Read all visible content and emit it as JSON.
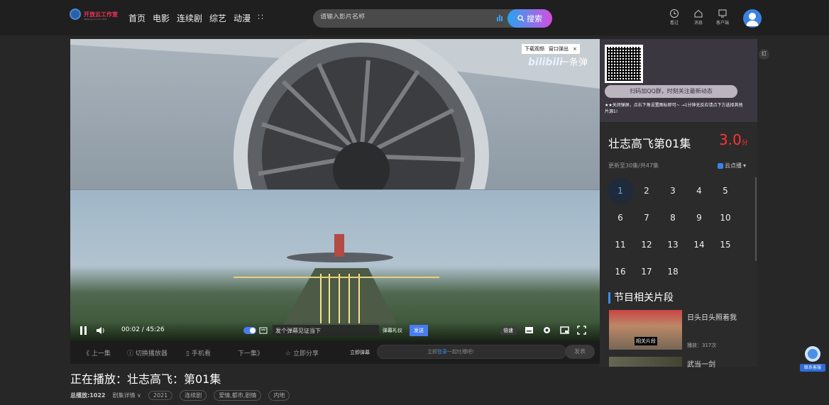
{
  "logo": {
    "name": "开放云工作室",
    "subtitle": "kaifangyun.com 2021"
  },
  "nav": {
    "items": [
      "首页",
      "电影",
      "连续剧",
      "综艺",
      "动漫"
    ],
    "more_icon": "grid-icon"
  },
  "search": {
    "placeholder": "请输入影片名称",
    "button": "搜索"
  },
  "top_icons": [
    {
      "label": "看过",
      "icon": "history-icon"
    },
    {
      "label": "消息",
      "icon": "home-icon"
    },
    {
      "label": "客户端",
      "icon": "tv-icon"
    }
  ],
  "player": {
    "download_label": "下载观频",
    "popout_label": "窗口弹出",
    "watermark": "bilibili",
    "floating_danmaku": "一条弹",
    "time": "00:02 / 45:26",
    "danmaku_toggle": "弹",
    "danmaku_placeholder": "发个弹幕见证当下",
    "danmaku_gift": "弹幕礼仪",
    "danmaku_send": "发送",
    "speed": "倍速"
  },
  "underbar": {
    "prev": "《 上一集",
    "switch_player": "切换播放器",
    "mobile": "手机看",
    "next": "下一集》",
    "share": "立即分享",
    "danmu_label": "立即弹幕",
    "input_prefix": "立即",
    "input_login": "登录",
    "input_suffix": "一起吐槽吧!",
    "send": "发表"
  },
  "side": {
    "promo_text": "扫码加QQ群，时刻关注最新动态",
    "promo_note": "★★关闭弹屏，点右下角设置图标即可~ →1分钟无反应请点下方选择其他片源1!",
    "title": "壮志高飞第01集",
    "score": "3.0",
    "score_unit": "分",
    "update": "更新至30集/共47集",
    "source": "云点播",
    "episodes": [
      "1",
      "2",
      "3",
      "4",
      "5",
      "6",
      "7",
      "8",
      "9",
      "10",
      "11",
      "12",
      "13",
      "14",
      "15",
      "16",
      "17",
      "18"
    ],
    "active_episode": "1",
    "clips_title": "节目相关片段",
    "clips": [
      {
        "title": "日头日头照着我",
        "plays": "播放：317次",
        "thumb_label": "相关片段"
      },
      {
        "title": "武当一剑"
      }
    ]
  },
  "now_playing": "正在播放：壮志高飞：第01集",
  "meta": {
    "plays": "总播放:1022",
    "detail": "剧集详情 ∨",
    "tags": [
      "2021",
      "连续剧",
      "爱情,都市,剧情",
      "内地"
    ]
  },
  "float_btn": "灯",
  "service_label": "联系客服"
}
